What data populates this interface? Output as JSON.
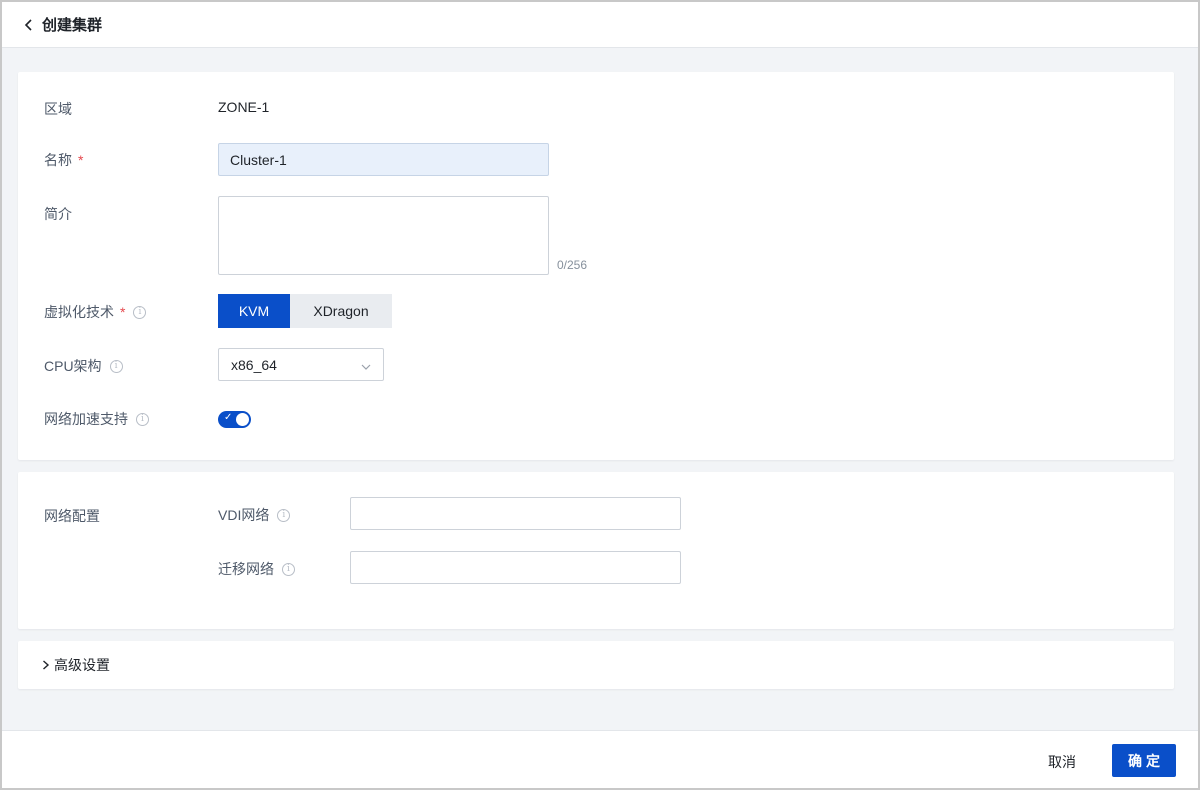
{
  "header": {
    "title": "创建集群"
  },
  "form": {
    "zone": {
      "label": "区域",
      "value": "ZONE-1"
    },
    "name": {
      "label": "名称",
      "required_mark": "*",
      "value": "Cluster-1"
    },
    "description": {
      "label": "简介",
      "value": "",
      "counter": "0/256"
    },
    "virtualization": {
      "label": "虚拟化技术",
      "required_mark": "*",
      "options": [
        "KVM",
        "XDragon"
      ],
      "selected": "KVM"
    },
    "cpu_arch": {
      "label": "CPU架构",
      "value": "x86_64"
    },
    "network_accel": {
      "label": "网络加速支持",
      "enabled": true
    }
  },
  "network": {
    "section_label": "网络配置",
    "vdi": {
      "label": "VDI网络",
      "value": ""
    },
    "migration": {
      "label": "迁移网络",
      "value": ""
    }
  },
  "advanced": {
    "label": "高级设置"
  },
  "footer": {
    "cancel_label": "取消",
    "ok_label": "确定"
  },
  "colors": {
    "primary": "#0a4fc9",
    "required": "#e5484d",
    "background": "#f2f4f7"
  }
}
